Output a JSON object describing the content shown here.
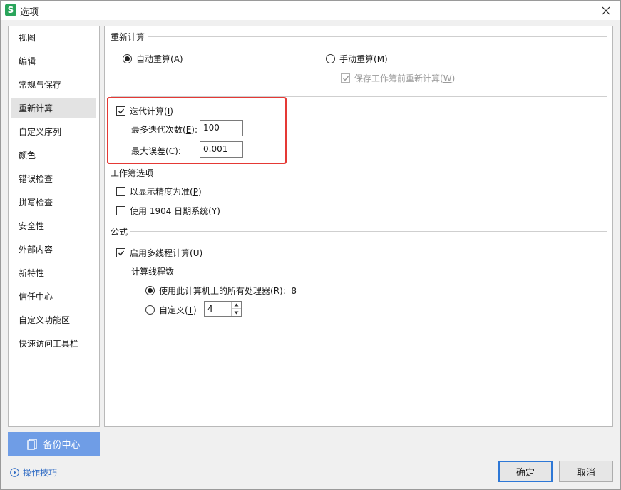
{
  "window": {
    "title": "选项",
    "app_icon_letter": "S"
  },
  "sidebar": {
    "items": [
      {
        "label": "视图"
      },
      {
        "label": "编辑"
      },
      {
        "label": "常规与保存"
      },
      {
        "label": "重新计算",
        "active": true
      },
      {
        "label": "自定义序列"
      },
      {
        "label": "颜色"
      },
      {
        "label": "错误检查"
      },
      {
        "label": "拼写检查"
      },
      {
        "label": "安全性"
      },
      {
        "label": "外部内容"
      },
      {
        "label": "新特性"
      },
      {
        "label": "信任中心"
      },
      {
        "label": "自定义功能区"
      },
      {
        "label": "快速访问工具栏"
      }
    ],
    "backup_label": "备份中心",
    "tips_label": "操作技巧"
  },
  "recalc": {
    "section_title": "重新计算",
    "auto": {
      "text": "自动重算(",
      "key": "A",
      "tail": ")",
      "selected": true
    },
    "manual": {
      "text": "手动重算(",
      "key": "M",
      "tail": ")",
      "selected": false
    },
    "save_before": {
      "text": "保存工作簿前重新计算(",
      "key": "W",
      "tail": ")",
      "checked": true,
      "disabled": true
    },
    "iteration": {
      "text": "迭代计算(",
      "key": "I",
      "tail": ")",
      "checked": true
    },
    "max_iter": {
      "text": "最多迭代次数(",
      "key": "E",
      "tail": "):",
      "value": "100"
    },
    "max_change": {
      "text": "最大误差(",
      "key": "C",
      "tail": "):",
      "value": "0.001"
    }
  },
  "workbook": {
    "section_title": "工作簿选项",
    "precision": {
      "text": "以显示精度为准(",
      "key": "P",
      "tail": ")",
      "checked": false
    },
    "date1904": {
      "text": "使用 1904 日期系统(",
      "key": "Y",
      "tail": ")",
      "checked": false
    }
  },
  "formula": {
    "section_title": "公式",
    "multithread": {
      "text": "启用多线程计算(",
      "key": "U",
      "tail": ")",
      "checked": true
    },
    "threads_label": "计算线程数",
    "all_processors": {
      "text": "使用此计算机上的所有处理器(",
      "key": "R",
      "tail": "):",
      "count": "8",
      "selected": true
    },
    "custom": {
      "text": "自定义(",
      "key": "T",
      "tail": ")",
      "selected": false,
      "value": "4"
    }
  },
  "buttons": {
    "ok": "确定",
    "cancel": "取消"
  },
  "colors": {
    "highlight_border": "#e53935",
    "backup_bg": "#6f9de6",
    "link": "#2f6bc4"
  }
}
